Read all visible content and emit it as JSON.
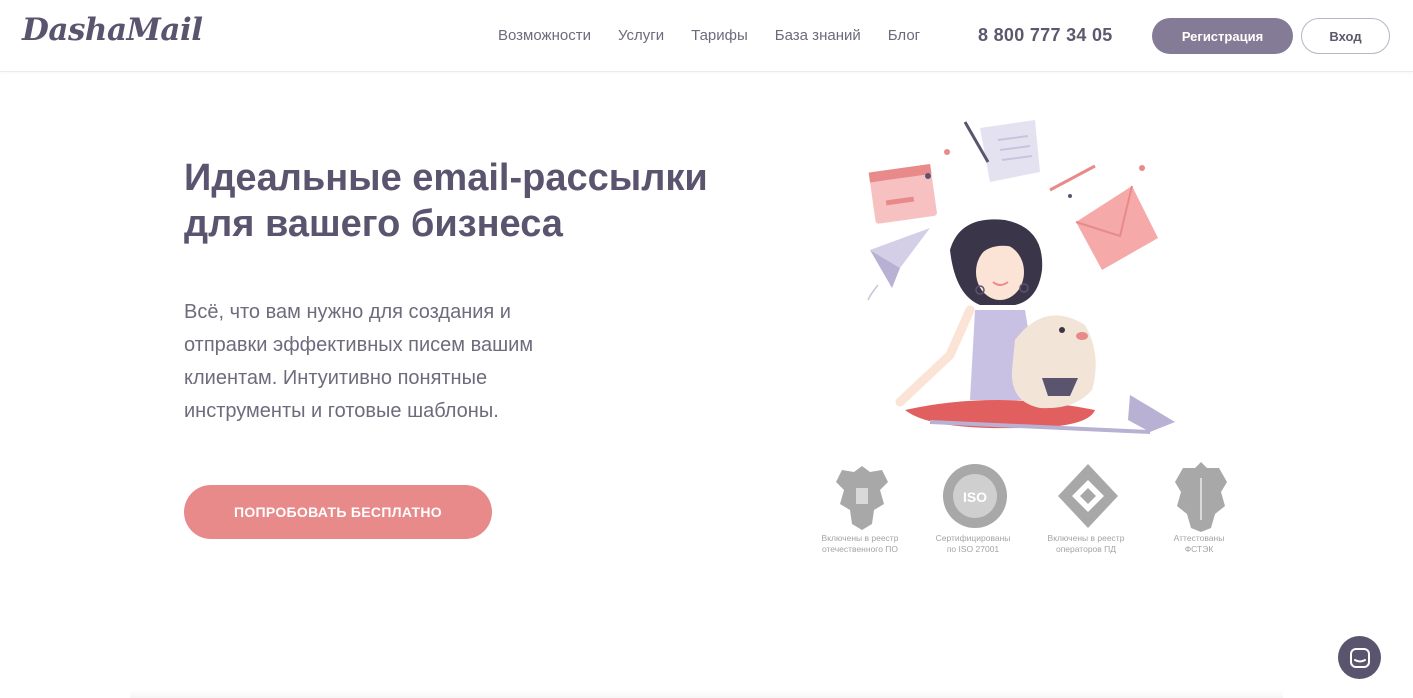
{
  "header": {
    "logo": "DashaMail",
    "nav": [
      "Возможности",
      "Услуги",
      "Тарифы",
      "База знаний",
      "Блог"
    ],
    "phone": "8 800 777 34 05",
    "register_label": "Регистрация",
    "login_label": "Вход"
  },
  "hero": {
    "title_line1": "Идеальные email-рассылки",
    "title_line2": "для вашего бизнеса",
    "subtitle_line1": "Всё, что вам нужно для создания и",
    "subtitle_line2": "отправки эффективных писем вашим",
    "subtitle_line3": "клиентам. Интуитивно понятные",
    "subtitle_line4": "инструменты и готовые шаблоны.",
    "cta_label": "ПОПРОБОВАТЬ БЕСПЛАТНО"
  },
  "badges": [
    {
      "icon": "coat-of-arms-icon",
      "line1": "Включены в реестр",
      "line2": "отечественного ПО"
    },
    {
      "icon": "iso-icon",
      "line1": "Сертифицированы",
      "line2": "по ISO 27001"
    },
    {
      "icon": "diamond-logo-icon",
      "line1": "Включены в реестр",
      "line2": "операторов ПД"
    },
    {
      "icon": "fstek-emblem-icon",
      "line1": "Аттестованы",
      "line2": "ФСТЭК"
    }
  ],
  "colors": {
    "brand": "#5b546f",
    "accent_button": "#847b97",
    "cta": "#e98a8a",
    "text": "#6f6b7d"
  }
}
